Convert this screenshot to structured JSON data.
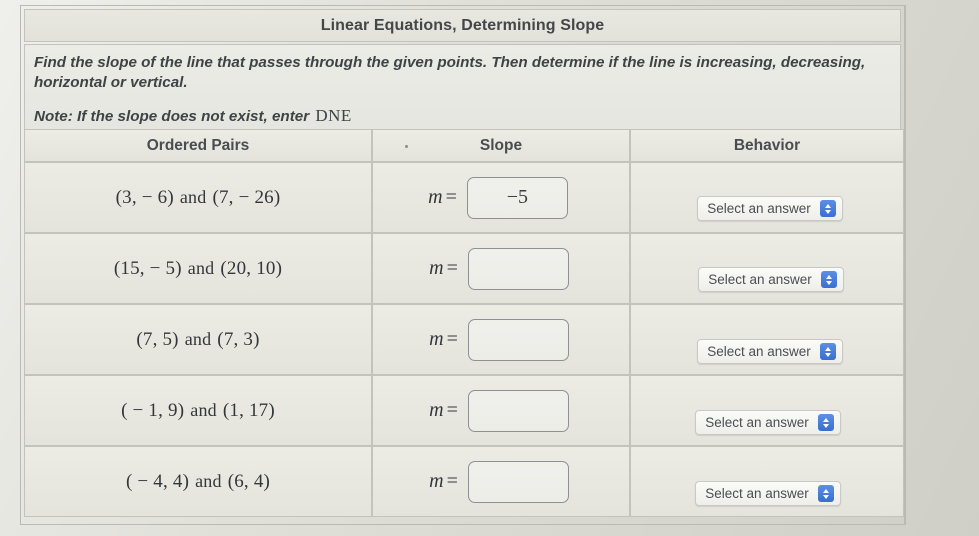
{
  "worksheet": {
    "title": "Linear Equations, Determining Slope",
    "instructions": "Find the slope of the line that passes through the given points. Then determine if the line is increasing, decreasing, horizontal or vertical.",
    "note_label": "Note:",
    "note_text": "If the slope does not exist, enter",
    "note_code": "DNE"
  },
  "table": {
    "headers": {
      "pairs": "Ordered Pairs",
      "slope": "Slope",
      "behavior": "Behavior"
    },
    "slope_prefix": "m",
    "equals": "=",
    "conjunction": "and",
    "rows": [
      {
        "point_a": "(3, − 6)",
        "point_b": "(7, − 26)",
        "slope_value": "−5",
        "slope_placeholder": "",
        "behavior_label": "Select an answer"
      },
      {
        "point_a": "(15, − 5)",
        "point_b": "(20, 10)",
        "slope_value": "",
        "slope_placeholder": "",
        "behavior_label": "Select an answer"
      },
      {
        "point_a": "(7, 5)",
        "point_b": "(7, 3)",
        "slope_value": "",
        "slope_placeholder": "",
        "behavior_label": "Select an answer"
      },
      {
        "point_a": "( − 1, 9)",
        "point_b": "(1, 17)",
        "slope_value": "",
        "slope_placeholder": "",
        "behavior_label": "Select an answer"
      },
      {
        "point_a": "( − 4, 4)",
        "point_b": "(6, 4)",
        "slope_value": "",
        "slope_placeholder": "",
        "behavior_label": "Select an answer"
      }
    ]
  },
  "colors": {
    "page_background": "#dcdcd4",
    "panel_background": "#e8e8e1",
    "border": "#c2c3bc",
    "text": "#44474a",
    "accent_blue": "#3a6ed0"
  }
}
